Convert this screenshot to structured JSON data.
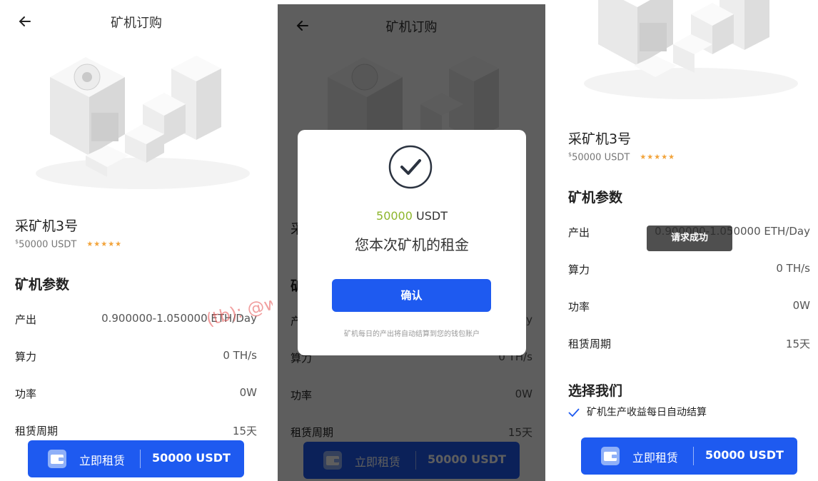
{
  "nav": {
    "title": "矿机订购"
  },
  "product": {
    "name": "采矿机3号",
    "currency_symbol": "$",
    "price": "50000 USDT",
    "rating_stars": "★★★★★"
  },
  "params": {
    "title": "矿机参数",
    "rows": [
      {
        "label": "产出",
        "value": "0.900000-1.050000 ETH/Day"
      },
      {
        "label": "算力",
        "value": "0 TH/s"
      },
      {
        "label": "功率",
        "value": "0W"
      },
      {
        "label": "租赁周期",
        "value": "15天"
      }
    ]
  },
  "rent_button": {
    "label": "立即租赁",
    "amount": "50000 USDT"
  },
  "watermark": "(tb): @welunt",
  "modal": {
    "amount_number": "50000",
    "amount_unit": " USDT",
    "description": "您本次矿机的租金",
    "confirm_label": "确认",
    "note": "矿机每日的产出将自动结算到您的钱包账户"
  },
  "why_us": {
    "title": "选择我们",
    "features": [
      "矿机生产收益每日自动结算"
    ]
  },
  "toast": "请求成功",
  "colors": {
    "primary": "#1e5af0",
    "star": "#f2a33a",
    "amount_green": "#8db62c",
    "overlay": "rgba(0,0,0,0.63)"
  },
  "icons": [
    "back-arrow-icon",
    "wallet-icon",
    "check-circle-icon",
    "check-icon"
  ]
}
